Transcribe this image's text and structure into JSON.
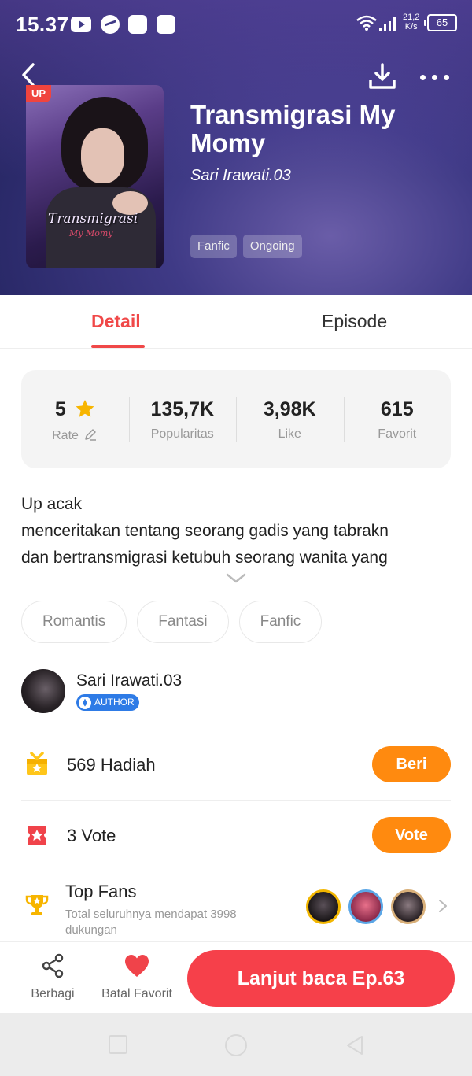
{
  "status_bar": {
    "time": "15.37",
    "net_speed_value": "21,2",
    "net_speed_unit": "K/s",
    "battery": "65"
  },
  "header": {
    "up_badge": "UP",
    "cover_title": "Transmigrasi",
    "cover_subtitle": "My Momy",
    "title": "Transmigrasi My Momy",
    "author": "Sari Irawati.03",
    "tags": [
      "Fanfic",
      "Ongoing"
    ]
  },
  "tabs": {
    "detail": "Detail",
    "episode": "Episode",
    "active": "detail"
  },
  "stats": {
    "rate": {
      "value": "5",
      "label": "Rate"
    },
    "popularity": {
      "value": "135,7K",
      "label": "Popularitas"
    },
    "likes": {
      "value": "3,98K",
      "label": "Like"
    },
    "favorites": {
      "value": "615",
      "label": "Favorit"
    }
  },
  "description": {
    "line1": "Up acak",
    "line2": "menceritakan tentang seorang gadis yang tabrakn",
    "line3": "dan bertransmigrasi ketubuh seorang wanita yang"
  },
  "genres": [
    "Romantis",
    "Fantasi",
    "Fanfic"
  ],
  "author_section": {
    "name": "Sari Irawati.03",
    "badge": "AUTHOR"
  },
  "gift_row": {
    "count": "569",
    "label": "Hadiah",
    "button": "Beri"
  },
  "vote_row": {
    "count": "3",
    "label": "Vote",
    "button": "Vote"
  },
  "top_fans": {
    "title": "Top Fans",
    "subtitle": "Total seluruhnya mendapat 3998 dukungan"
  },
  "bottom_bar": {
    "share": "Berbagi",
    "unfavorite": "Batal Favorit",
    "continue": "Lanjut baca Ep.63"
  },
  "colors": {
    "accent_red": "#f04848",
    "button_orange": "#ff8a0f",
    "continue_red": "#f6404a",
    "author_blue": "#2e7be6",
    "header_purple": "#3f3a86"
  }
}
